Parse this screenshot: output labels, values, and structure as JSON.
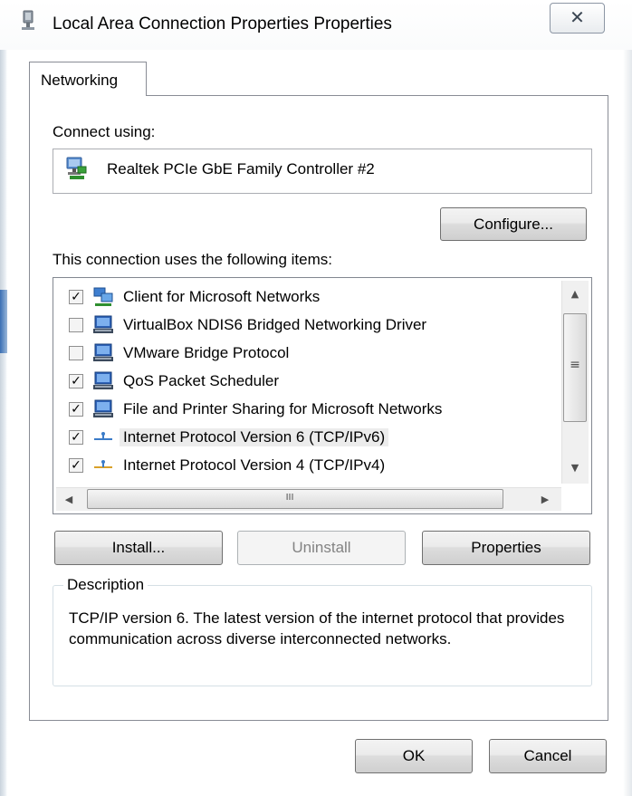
{
  "window": {
    "title": "Local Area Connection Properties Properties",
    "close_glyph": "✕"
  },
  "tabs": [
    {
      "label": "Networking",
      "active": true
    }
  ],
  "connect_using": {
    "label": "Connect using:",
    "device": "Realtek PCIe GbE Family Controller #2",
    "device_icon": "network-adapter-icon"
  },
  "buttons": {
    "configure": "Configure...",
    "install": "Install...",
    "uninstall": "Uninstall",
    "properties": "Properties",
    "ok": "OK",
    "cancel": "Cancel"
  },
  "items_label": "This connection uses the following items:",
  "items": [
    {
      "label": "Client for Microsoft Networks",
      "checked": true,
      "icon": "client-network-icon"
    },
    {
      "label": "VirtualBox NDIS6 Bridged Networking Driver",
      "checked": false,
      "icon": "network-service-icon"
    },
    {
      "label": "VMware Bridge Protocol",
      "checked": false,
      "icon": "network-service-icon"
    },
    {
      "label": "QoS Packet Scheduler",
      "checked": true,
      "icon": "network-service-icon"
    },
    {
      "label": "File and Printer Sharing for Microsoft Networks",
      "checked": true,
      "icon": "network-service-icon"
    },
    {
      "label": "Internet Protocol Version 6 (TCP/IPv6)",
      "checked": true,
      "icon": "protocol-icon",
      "selected": true
    },
    {
      "label": "Internet Protocol Version 4 (TCP/IPv4)",
      "checked": true,
      "icon": "protocol-icon"
    }
  ],
  "scroll": {
    "up": "▲",
    "down": "▼",
    "left": "◀",
    "right": "▶",
    "grip_v": "≡",
    "grip_h": "III"
  },
  "description": {
    "label": "Description",
    "text": "TCP/IP version 6. The latest version of the internet protocol that provides communication across diverse interconnected networks."
  },
  "colors": {
    "checkbox_checked": "#000000",
    "selection_bg": "#ececec",
    "protocol_icon": "#3a7bc8"
  }
}
